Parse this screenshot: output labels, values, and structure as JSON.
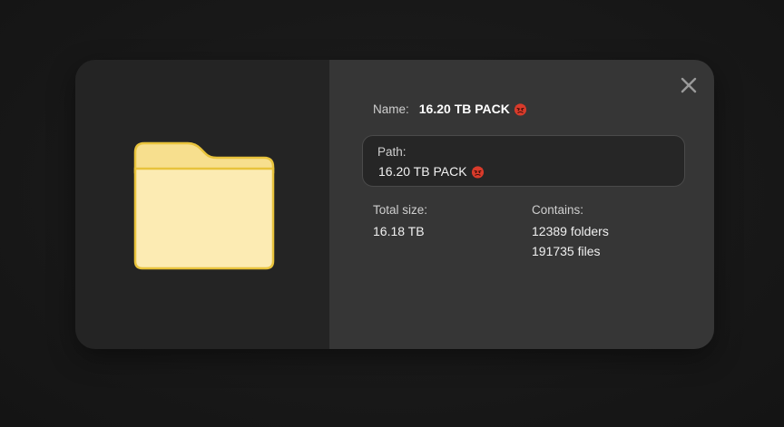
{
  "dialog": {
    "name_label": "Name:",
    "name_value": "16.20 TB PACK",
    "path_label": "Path:",
    "path_value": "16.20 TB PACK",
    "name_emoji": "angry-devil-emoji",
    "total_size_label": "Total size:",
    "total_size_value": "16.18 TB",
    "contains_label": "Contains:",
    "contains_folders": "12389 folders",
    "contains_files": "191735 files"
  },
  "icons": {
    "folder": "folder-icon",
    "close": "close-icon"
  },
  "colors": {
    "folder_fill": "#fcebb3",
    "folder_stroke": "#e8c33c",
    "left_pane": "#242424",
    "right_pane": "#363636"
  }
}
